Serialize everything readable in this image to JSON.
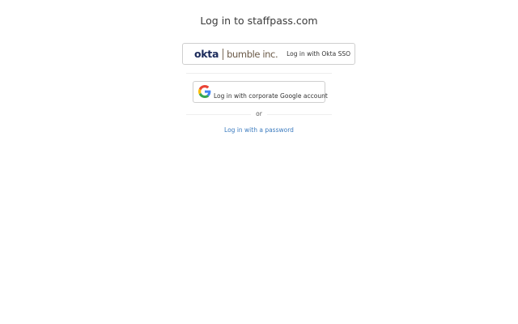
{
  "page": {
    "title": "Log in to staffpass.com"
  },
  "okta": {
    "logo_text": "okta",
    "partner_text": "bumble inc.",
    "label": "Log in with Okta SSO"
  },
  "google": {
    "label": "Log in with corporate Google account",
    "colors": {
      "blue": "#4285F4",
      "red": "#EA4335",
      "yellow": "#FBBC05",
      "green": "#34A853"
    }
  },
  "separator": {
    "text": "or"
  },
  "password": {
    "link_text": "Log in with a password",
    "color": "#3b7bbf"
  }
}
